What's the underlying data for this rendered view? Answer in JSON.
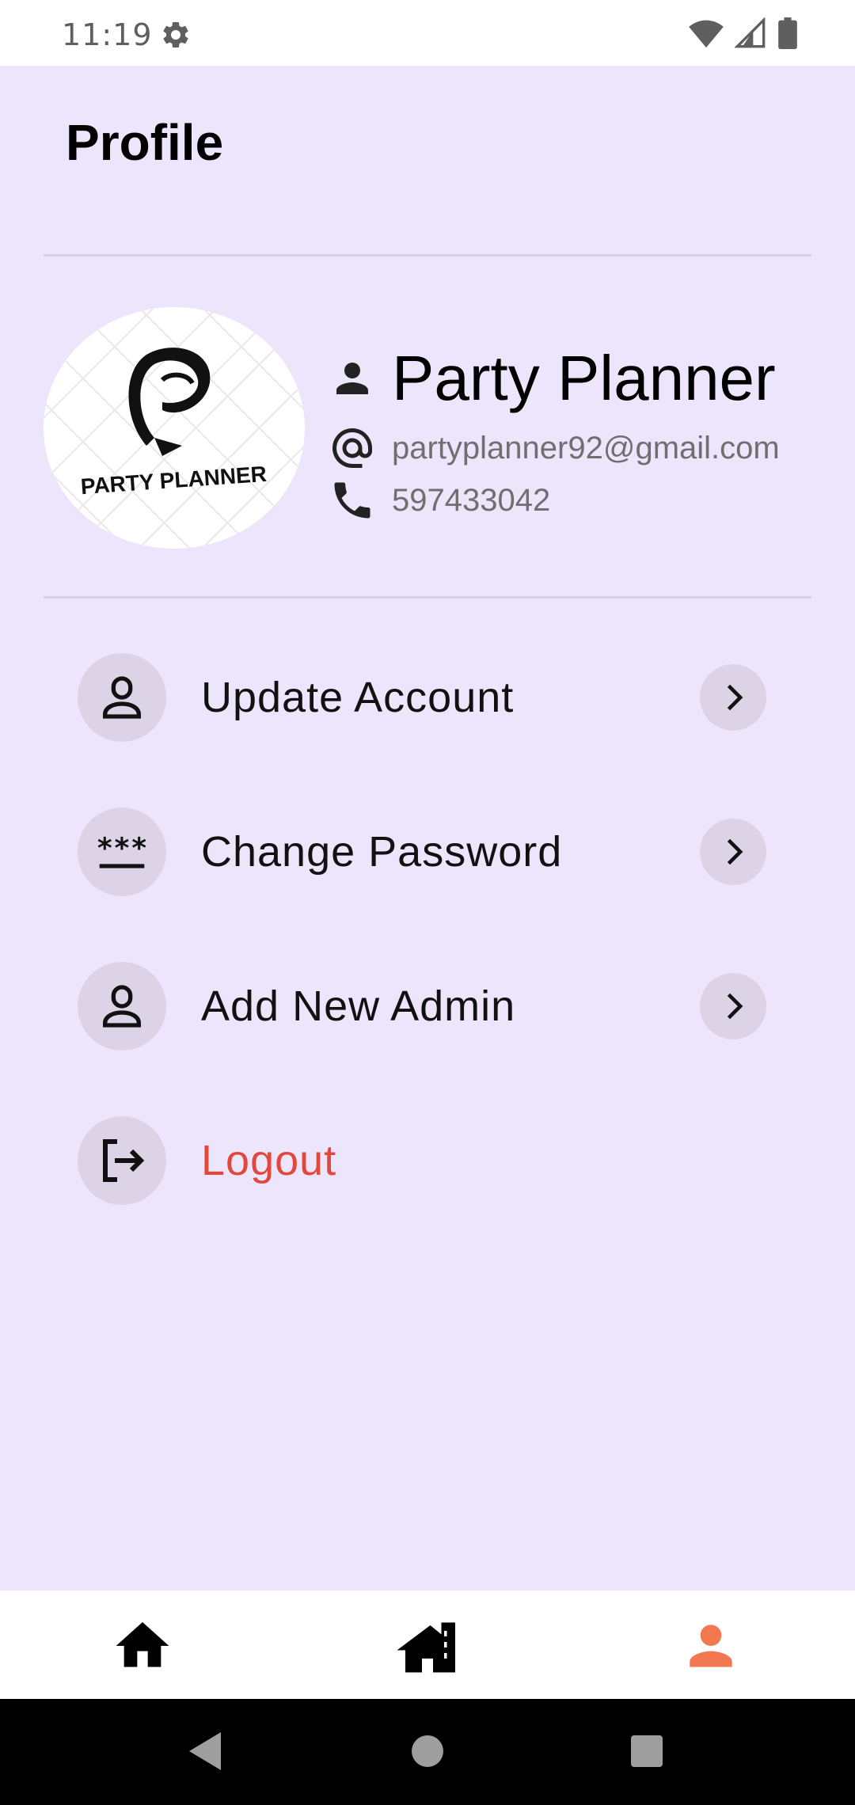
{
  "status_bar": {
    "time": "11:19",
    "icons": [
      "settings-icon",
      "wifi-icon",
      "signal-icon",
      "battery-icon"
    ]
  },
  "header": {
    "title": "Profile"
  },
  "profile": {
    "name": "Party Planner",
    "email": "partyplanner92@gmail.com",
    "phone": "597433042",
    "logo_text": "PARTY PLANNER"
  },
  "menu": {
    "items": [
      {
        "label": "Update Account",
        "icon": "account-icon"
      },
      {
        "label": "Change Password",
        "icon": "password-icon"
      },
      {
        "label": "Add New Admin",
        "icon": "admin-icon"
      },
      {
        "label": "Logout",
        "icon": "logout-icon"
      }
    ]
  },
  "bottom_nav": {
    "items": [
      "home-icon",
      "buildings-icon",
      "profile-icon"
    ],
    "active_color": "#f4784f"
  },
  "colors": {
    "background": "#ede5fc",
    "logout": "#e2463c",
    "chip": "#dcd4e6"
  }
}
